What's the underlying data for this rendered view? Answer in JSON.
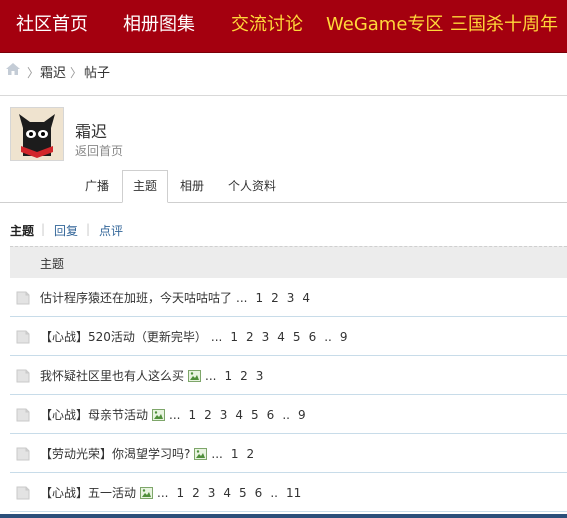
{
  "topnav": {
    "items": [
      {
        "label": "社区首页",
        "color": "#ffffff"
      },
      {
        "label": "相册图集",
        "color": "#ffffff"
      },
      {
        "label": "交流讨论",
        "color": "#ffd83a"
      },
      {
        "label": "WeGame专区",
        "color": "#ffd83a"
      },
      {
        "label": "三国杀十周年",
        "color": "#ffd83a"
      }
    ],
    "background": "#a4000f"
  },
  "breadcrumb": {
    "home_icon": "home-icon",
    "items": [
      "霜迟",
      "帖子"
    ]
  },
  "profile": {
    "name": "霜迟",
    "back_link": "返回首页",
    "avatar_icon": "black-cat-avatar"
  },
  "tabs": [
    "广播",
    "主题",
    "相册",
    "个人资料"
  ],
  "active_tab": "主题",
  "subnav": {
    "items": [
      "主题",
      "回复",
      "点评"
    ],
    "active": "主题"
  },
  "table": {
    "header": "主题",
    "rows": [
      {
        "title": "估计程序猿还在加班，今天咕咕咕了",
        "has_image": false,
        "pages": [
          "1",
          "2",
          "3",
          "4"
        ]
      },
      {
        "title": "【心战】520活动（更新完毕）",
        "has_image": false,
        "pages": [
          "1",
          "2",
          "3",
          "4",
          "5",
          "6",
          "..",
          "9"
        ]
      },
      {
        "title": "我怀疑社区里也有人这么买",
        "has_image": true,
        "pages": [
          "1",
          "2",
          "3"
        ]
      },
      {
        "title": "【心战】母亲节活动",
        "has_image": true,
        "pages": [
          "1",
          "2",
          "3",
          "4",
          "5",
          "6",
          "..",
          "9"
        ]
      },
      {
        "title": "【劳动光荣】你渴望学习吗?",
        "has_image": true,
        "pages": [
          "1",
          "2"
        ]
      },
      {
        "title": "【心战】五一活动",
        "has_image": true,
        "pages": [
          "1",
          "2",
          "3",
          "4",
          "5",
          "6",
          "..",
          "11"
        ]
      }
    ]
  }
}
